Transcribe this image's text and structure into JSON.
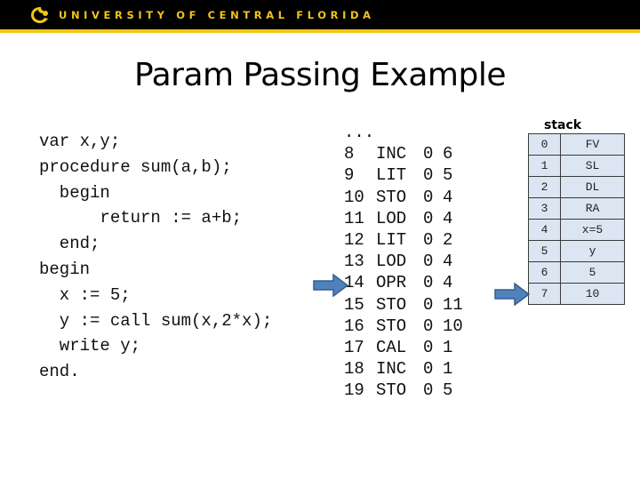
{
  "header": {
    "university": "UNIVERSITY OF CENTRAL FLORIDA",
    "logo_icon": "pegasus-logo-icon",
    "brand_color": "#f0c419",
    "banner_color": "#000000"
  },
  "slide": {
    "title": "Param Passing Example"
  },
  "source_code": {
    "lines": [
      "var x,y;",
      "procedure sum(a,b);",
      "  begin",
      "      return := a+b;",
      "  end;",
      "begin",
      "  x := 5;",
      "  y := call sum(x,2*x);",
      "  write y;",
      "end."
    ]
  },
  "instructions": {
    "ellipsis": "...",
    "rows": [
      {
        "line": "8",
        "op": "INC",
        "l": "0",
        "m": "6"
      },
      {
        "line": "9",
        "op": "LIT",
        "l": "0",
        "m": "5"
      },
      {
        "line": "10",
        "op": "STO",
        "l": "0",
        "m": "4"
      },
      {
        "line": "11",
        "op": "LOD",
        "l": "0",
        "m": "4"
      },
      {
        "line": "12",
        "op": "LIT",
        "l": "0",
        "m": "2"
      },
      {
        "line": "13",
        "op": "LOD",
        "l": "0",
        "m": "4"
      },
      {
        "line": "14",
        "op": "OPR",
        "l": "0",
        "m": "4"
      },
      {
        "line": "15",
        "op": "STO",
        "l": "0",
        "m": "11"
      },
      {
        "line": "16",
        "op": "STO",
        "l": "0",
        "m": "10"
      },
      {
        "line": "17",
        "op": "CAL",
        "l": "0",
        "m": "1"
      },
      {
        "line": "18",
        "op": "INC",
        "l": "0",
        "m": "1"
      },
      {
        "line": "19",
        "op": "STO",
        "l": "0",
        "m": "5"
      }
    ],
    "current_pointer": "between 14 and 15"
  },
  "stack": {
    "label": "stack",
    "cells": [
      {
        "index": "0",
        "value": "FV"
      },
      {
        "index": "1",
        "value": "SL"
      },
      {
        "index": "2",
        "value": "DL"
      },
      {
        "index": "3",
        "value": "RA"
      },
      {
        "index": "4",
        "value": "x=5"
      },
      {
        "index": "5",
        "value": "y"
      },
      {
        "index": "6",
        "value": "5"
      },
      {
        "index": "7",
        "value": "10"
      }
    ],
    "top_pointer_index": "7",
    "cell_color": "#dce6f2",
    "arrow_color": "#4f81bd"
  }
}
